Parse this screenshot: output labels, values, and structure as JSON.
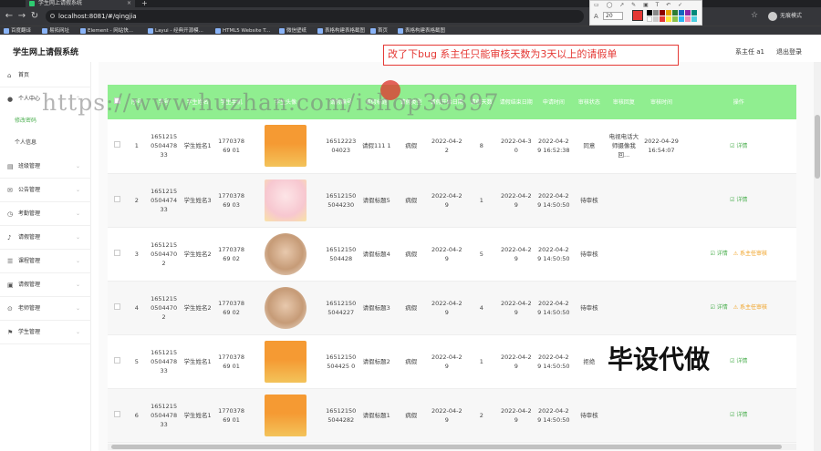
{
  "browser": {
    "tab_title": "学生网上请假系统",
    "url": "localhost:8081/#/qingjia",
    "profile": "无痕模式",
    "bookmarks": [
      "百度翻译",
      "易拓网址",
      "Element - 网站快...",
      "Layui - 经典开源模...",
      "HTML5 Website T...",
      "微信壁纸",
      "表格构建表格截图",
      "首页",
      "表格构建表格截图"
    ]
  },
  "annotation_tool": {
    "font_label": "A",
    "font_size": "20"
  },
  "app": {
    "title": "学生网上请假系统",
    "role_user": "系主任 a1",
    "logout": "退出登录"
  },
  "bug_note": "改了下bug  系主任只能审核天数为3天以上的请假单",
  "watermark": "https://www.huzhan.com/ishop39397",
  "overlay_text": "毕设代做",
  "sidebar": {
    "items": [
      {
        "label": "首页",
        "icon": "home-icon"
      },
      {
        "label": "个人中心",
        "icon": "user-icon"
      },
      {
        "label": "班级管理",
        "icon": "class-icon"
      },
      {
        "label": "公告管理",
        "icon": "mail-icon"
      },
      {
        "label": "考勤管理",
        "icon": "clock-icon"
      },
      {
        "label": "请假管理",
        "icon": "leave-icon"
      },
      {
        "label": "课程管理",
        "icon": "book-icon"
      },
      {
        "label": "请假管理",
        "icon": "leave-icon"
      },
      {
        "label": "老师管理",
        "icon": "teacher-icon"
      },
      {
        "label": "学生管理",
        "icon": "student-icon"
      }
    ],
    "subitems": [
      "修改密码",
      "个人信息"
    ]
  },
  "table": {
    "headers": [
      "",
      "序号",
      "学号",
      "学生姓名",
      "学生手机",
      "学生头像",
      "请假编号",
      "请假标题",
      "请假类型",
      "请假开始日期",
      "请假天数",
      "请假结束日期",
      "申请时间",
      "审核状态",
      "审核回复",
      "审核时间",
      "操作"
    ],
    "rows": [
      {
        "idx": "1",
        "sid": "1651215050447833",
        "sname": "学生姓名1",
        "phone": "177037869 01",
        "avatar": "t1",
        "no": "16512223 04023",
        "title": "请假111 1",
        "type": "病假",
        "start": "2022-04-22",
        "days": "8",
        "end": "2022-04-30",
        "apply": "2022-04-29 16:52:38",
        "status": "同意",
        "reply": "电视电话大师摄像我回...",
        "review_time": "2022-04-29 16:54:07",
        "actions": [
          "详情"
        ]
      },
      {
        "idx": "2",
        "sid": "1651215050447433",
        "sname": "学生姓名3",
        "phone": "177037869 03",
        "avatar": "t2",
        "no": "16512150 5044230",
        "title": "请假标题5",
        "type": "病假",
        "start": "2022-04-29",
        "days": "1",
        "end": "2022-04-29",
        "apply": "2022-04-29 14:50:50",
        "status": "待审核",
        "reply": "",
        "review_time": "",
        "actions": [
          "详情"
        ]
      },
      {
        "idx": "3",
        "sid": "165121505044702",
        "sname": "学生姓名2",
        "phone": "177037869 02",
        "avatar": "t3",
        "no": "16512150 504428",
        "title": "请假标题4",
        "type": "病假",
        "start": "2022-04-29",
        "days": "5",
        "end": "2022-04-29",
        "apply": "2022-04-29 14:50:50",
        "status": "待审核",
        "reply": "",
        "review_time": "",
        "actions": [
          "详情",
          "系主任审核"
        ]
      },
      {
        "idx": "4",
        "sid": "165121505044702",
        "sname": "学生姓名2",
        "phone": "177037869 02",
        "avatar": "t3",
        "no": "16512150 5044227",
        "title": "请假标题3",
        "type": "病假",
        "start": "2022-04-29",
        "days": "4",
        "end": "2022-04-29",
        "apply": "2022-04-29 14:50:50",
        "status": "待审核",
        "reply": "",
        "review_time": "",
        "actions": [
          "详情",
          "系主任审核"
        ]
      },
      {
        "idx": "5",
        "sid": "1651215050447833",
        "sname": "学生姓名1",
        "phone": "177037869 01",
        "avatar": "t1",
        "no": "16512150 504425 0",
        "title": "请假标题2",
        "type": "病假",
        "start": "2022-04-29",
        "days": "1",
        "end": "2022-04-29",
        "apply": "2022-04-29 14:50:50",
        "status": "拒绝",
        "reply": "",
        "review_time": "",
        "actions": [
          "详情"
        ]
      },
      {
        "idx": "6",
        "sid": "1651215050447833",
        "sname": "学生姓名1",
        "phone": "177037869 01",
        "avatar": "t1",
        "no": "16512150 5044282",
        "title": "请假标题1",
        "type": "病假",
        "start": "2022-04-29",
        "days": "2",
        "end": "2022-04-29",
        "apply": "2022-04-29 14:50:50",
        "status": "待审核",
        "reply": "",
        "review_time": "",
        "actions": [
          "详情"
        ]
      }
    ]
  }
}
